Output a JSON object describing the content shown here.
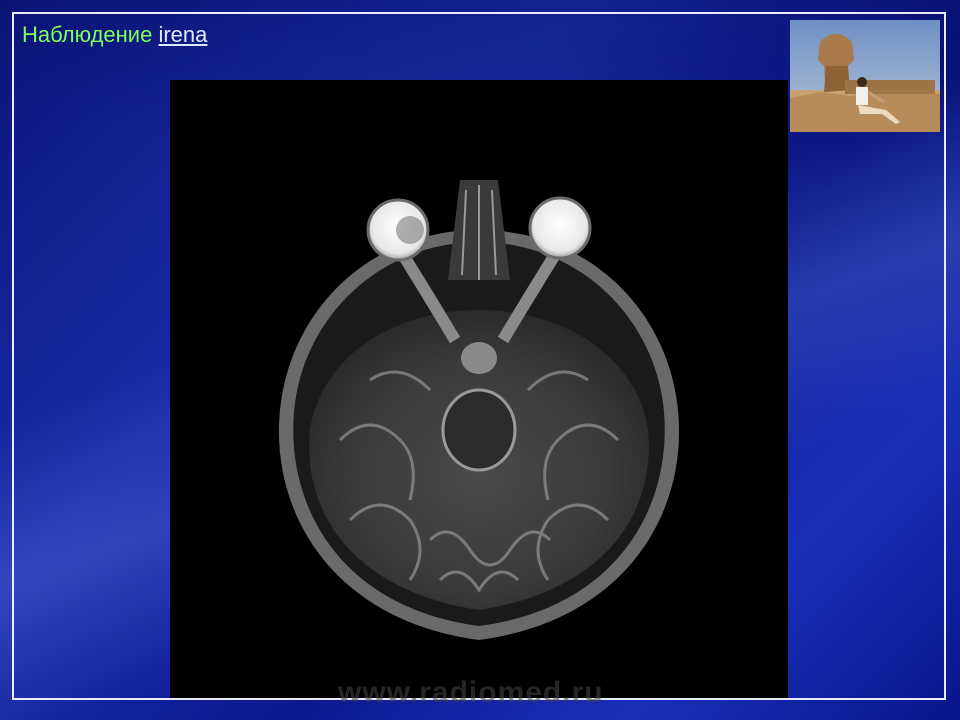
{
  "slide": {
    "title_word": "Наблюдение",
    "title_link": "irena",
    "watermark": "www.radiomed.ru",
    "colors": {
      "background": "#1426a8",
      "title_word": "#7cff5a",
      "title_link": "#e0e8ff",
      "border": "#e8ecf8"
    }
  },
  "images": {
    "scan": "axial-t2-mri-brain",
    "photo": "person-sitting-near-sphinx"
  }
}
